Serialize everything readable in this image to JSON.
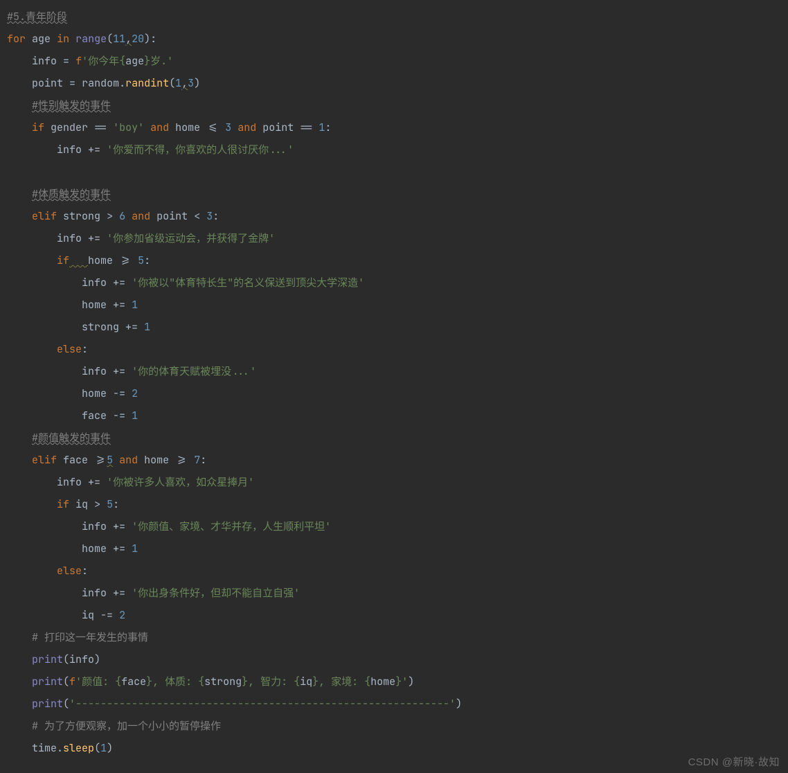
{
  "watermark": "CSDN @新晓·故知",
  "code": {
    "comment_stage": "#5.青年阶段",
    "for_kw": "for",
    "age_id": "age",
    "in_kw": "in",
    "range_fn": "range",
    "num_11": "11",
    "num_20": "20",
    "info_id": "info",
    "eq_op": "=",
    "f_prefix": "f",
    "str_age": "'你今年{age}岁.'",
    "point_id": "point",
    "random_id": "random",
    "randint_fn": "randint",
    "num_1": "1",
    "num_3": "3",
    "comment_gender": "#性别触发的事件",
    "if_kw": "if",
    "gender_id": "gender",
    "eqeq": "==",
    "str_boy": "'boy'",
    "and_kw": "and",
    "home_id": "home",
    "le": "<=",
    "info_pluseq": "+=",
    "str_love": "'你爱而不得，你喜欢的人很讨厌你...'",
    "comment_strong": "#体质触发的事件",
    "elif_kw": "elif",
    "strong_id": "strong",
    "gt": ">",
    "lt": "<",
    "num_6": "6",
    "str_sports": "'你参加省级运动会，并获得了金牌'",
    "ge": ">=",
    "num_5": "5",
    "str_univ": "'你被以\"体育特长生\"的名义保送到顶尖大学深造'",
    "home_pluseq": "+=",
    "num_1b": "1",
    "strong_pluseq": "+=",
    "else_kw": "else",
    "str_buried": "'你的体育天赋被埋没...'",
    "minuseq": "-=",
    "num_2": "2",
    "face_id": "face",
    "comment_face": "#颜值触发的事件",
    "num_7": "7",
    "str_liked": "'你被许多人喜欢，如众星捧月'",
    "iq_id": "iq",
    "str_both": "'你颜值、家境、才华并存，人生顺利平坦'",
    "str_cant": "'你出身条件好，但却不能自立自强'",
    "comment_print": "# 打印这一年发生的事情",
    "print_fn": "print",
    "fstr_stats_open": "'颜值: {",
    "fstr_stats_mid1": "}, 体质: {",
    "fstr_stats_mid2": "}, 智力: {",
    "fstr_stats_mid3": "}, 家境: {",
    "fstr_stats_end": "}'",
    "str_dashes": "'------------------------------------------------------------'",
    "comment_sleep": "# 为了方便观察，加一个小小的暂停操作",
    "time_id": "time",
    "sleep_fn": "sleep"
  }
}
